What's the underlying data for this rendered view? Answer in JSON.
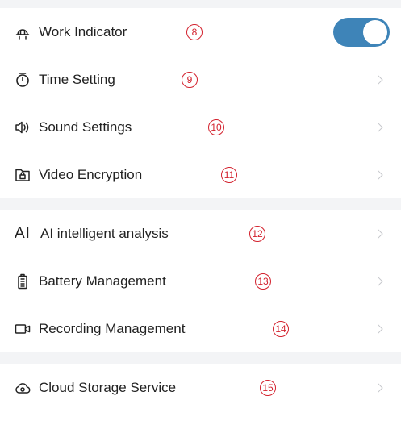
{
  "groups": [
    {
      "items": [
        {
          "label": "Work Indicator",
          "badge": "8",
          "icon": "lamp-icon",
          "control": "toggle",
          "toggle_on": true,
          "toggle_color": "#3e84b8"
        },
        {
          "label": "Time Setting",
          "badge": "9",
          "icon": "timer-icon",
          "control": "chevron"
        },
        {
          "label": "Sound Settings",
          "badge": "10",
          "icon": "speaker-icon",
          "control": "chevron"
        },
        {
          "label": "Video Encryption",
          "badge": "11",
          "icon": "encrypted-folder-icon",
          "control": "chevron"
        }
      ]
    },
    {
      "items": [
        {
          "label": "AI intelligent analysis",
          "badge": "12",
          "icon_text": "AI",
          "icon": "ai-icon",
          "control": "chevron"
        },
        {
          "label": "Battery Management",
          "badge": "13",
          "icon": "battery-icon",
          "control": "chevron"
        },
        {
          "label": "Recording Management",
          "badge": "14",
          "icon": "video-camera-icon",
          "control": "chevron"
        }
      ]
    },
    {
      "items": [
        {
          "label": "Cloud Storage Service",
          "badge": "15",
          "icon": "cloud-icon",
          "control": "chevron"
        }
      ]
    }
  ],
  "colors": {
    "accent": "#3e84b8",
    "badge": "#d3212d",
    "separator": "#f3f4f6",
    "chevron": "#c5c7cb"
  }
}
